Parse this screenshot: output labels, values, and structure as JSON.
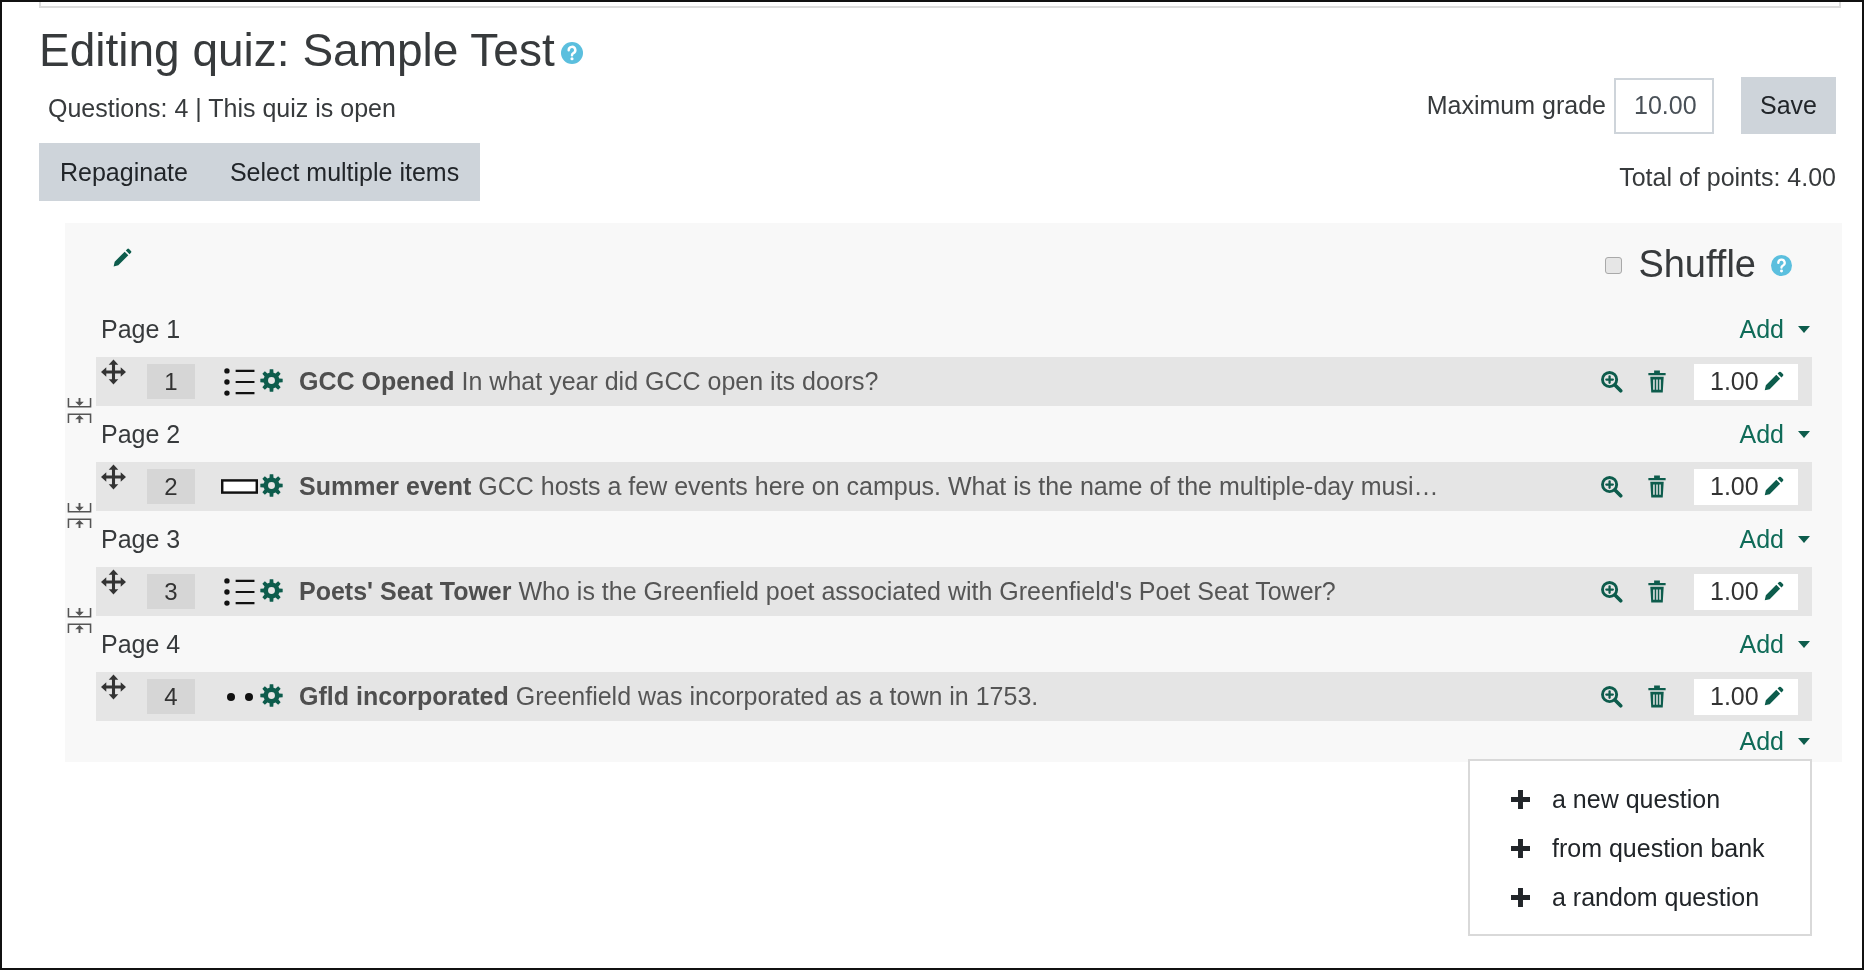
{
  "header": {
    "title": "Editing quiz: Sample Test",
    "summary": "Questions: 4 | This quiz is open",
    "buttons": [
      "Repaginate",
      "Select multiple items"
    ]
  },
  "grade": {
    "label": "Maximum grade",
    "value": "10.00",
    "button": "Save",
    "total": "Total of points: 4.00"
  },
  "section": {
    "shuffle": {
      "label": "Shuffle",
      "checked": false
    },
    "pages": [
      {
        "label": "Page 1",
        "add": "Add",
        "questions": [
          {
            "number": "1",
            "kind": "multichoice",
            "name": "GCC Opened",
            "text": "In what year did GCC open its doors?",
            "mark": "1.00"
          }
        ]
      },
      {
        "label": "Page 2",
        "add": "Add",
        "questions": [
          {
            "number": "2",
            "kind": "shortanswer",
            "name": "Summer event",
            "text": "GCC hosts a few events here on campus. What is the name of the multiple-day musi…",
            "mark": "1.00"
          }
        ]
      },
      {
        "label": "Page 3",
        "add": "Add",
        "questions": [
          {
            "number": "3",
            "kind": "multichoice",
            "name": "Poets' Seat Tower",
            "text": "Who is the Greenfield poet associated with Greenfield's Poet Seat Tower?",
            "mark": "1.00"
          }
        ]
      },
      {
        "label": "Page 4",
        "add": "Add",
        "questions": [
          {
            "number": "4",
            "kind": "truefalse",
            "name": "Gfld incorporated",
            "text": "Greenfield was incorporated as a town in 1753.",
            "mark": "1.00"
          }
        ]
      }
    ],
    "end_add": {
      "label": "Add",
      "expanded": true,
      "menu": [
        "a new question",
        "from question bank",
        "a random question"
      ]
    }
  }
}
